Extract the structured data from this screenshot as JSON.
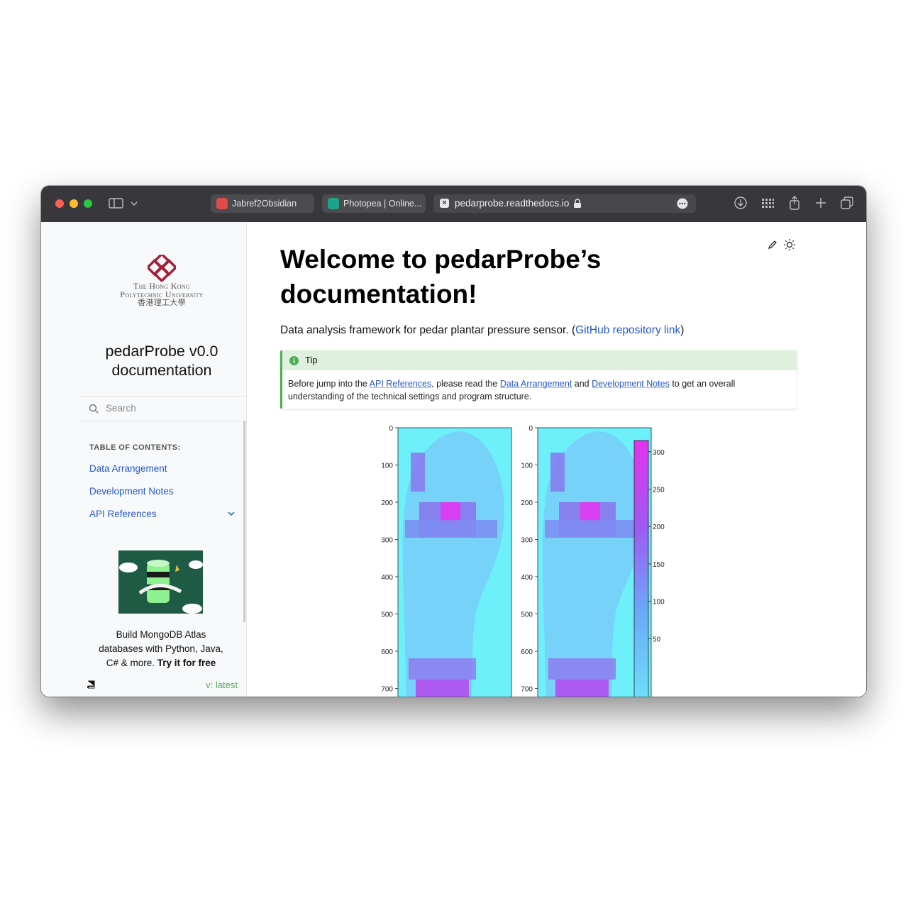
{
  "browser": {
    "tabs": [
      {
        "label": "Jabref2Obsidian"
      },
      {
        "label": "Photopea | Online..."
      }
    ],
    "address": "pedarprobe.readthedocs.io"
  },
  "sidebar": {
    "logo_line1": "The Hong Kong",
    "logo_line2": "Polytechnic University",
    "logo_line3": "香港理工大學",
    "title_line1": "pedarProbe v0.0",
    "title_line2": "documentation",
    "search_placeholder": "Search",
    "toc_heading": "TABLE OF CONTENTS:",
    "toc": [
      {
        "label": "Data Arrangement"
      },
      {
        "label": "Development Notes"
      },
      {
        "label": "API References"
      }
    ],
    "ad_line1": "Build MongoDB Atlas",
    "ad_line2": "databases with Python, Java,",
    "ad_line3": "C# & more.",
    "ad_cta": "Try it for free",
    "version": "v: latest"
  },
  "main": {
    "title_line1": "Welcome to pedarProbe’s",
    "title_line2": "documentation!",
    "intro_text": "Data analysis framework for pedar plantar pressure sensor. (",
    "intro_link": "GitHub repository link",
    "intro_close": ")",
    "tip": {
      "title": "Tip",
      "t1": "Before jump into the ",
      "l1": "API References",
      "t2": ", please read the ",
      "l2": "Data Arrangement",
      "t3": " and ",
      "l3": "Development Notes",
      "t4": " to get an overall",
      "line2": "understanding of the technical settings and program structure."
    }
  },
  "chart_data": {
    "type": "heatmap",
    "panels": 2,
    "y_ticks": [
      0,
      100,
      200,
      300,
      400,
      500,
      600,
      700
    ],
    "colorbar_ticks": [
      300,
      250,
      200,
      150,
      100,
      50
    ],
    "colorbar_range": [
      0,
      300
    ],
    "colormap": [
      "#6ef0fb",
      "#e532f0"
    ]
  }
}
